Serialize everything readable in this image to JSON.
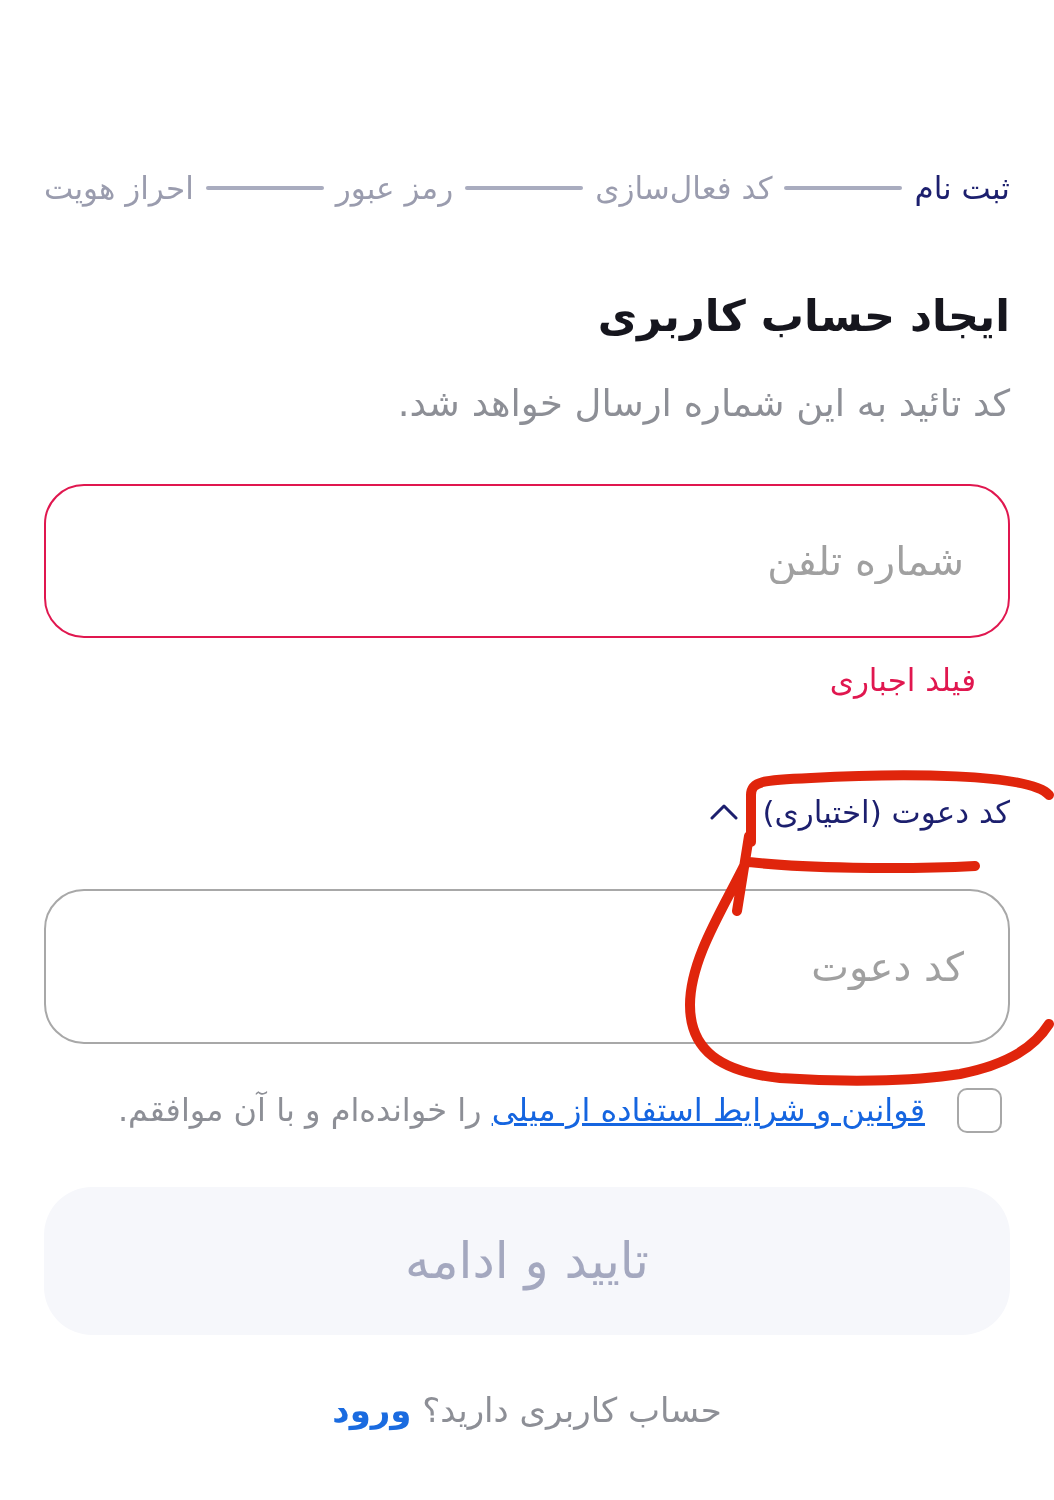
{
  "stepper": {
    "steps": [
      {
        "label": "ثبت نام",
        "active": true
      },
      {
        "label": "کد فعال‌سازی",
        "active": false
      },
      {
        "label": "رمز عبور",
        "active": false
      },
      {
        "label": "احراز هویت",
        "active": false
      }
    ]
  },
  "heading": {
    "title": "ایجاد حساب کاربری",
    "subtitle": "کد تائید به این شماره ارسال خواهد شد."
  },
  "phone_field": {
    "placeholder": "شماره تلفن",
    "invalid": true,
    "error": "فیلد اجباری"
  },
  "invite": {
    "label": "کد دعوت (اختیاری)",
    "expanded": true,
    "field": {
      "placeholder": "کد دعوت"
    }
  },
  "terms": {
    "checked": false,
    "link": "قوانین و شرایط استفاده از میلی",
    "text": " را خوانده‌ام و با آن موافقم."
  },
  "submit_button": {
    "label": "تایید و ادامه",
    "disabled": true
  },
  "footer": {
    "text": "حساب کاربری دارید؟ ",
    "link": "ورود"
  },
  "markup": {
    "kind": "freehand_circle"
  }
}
